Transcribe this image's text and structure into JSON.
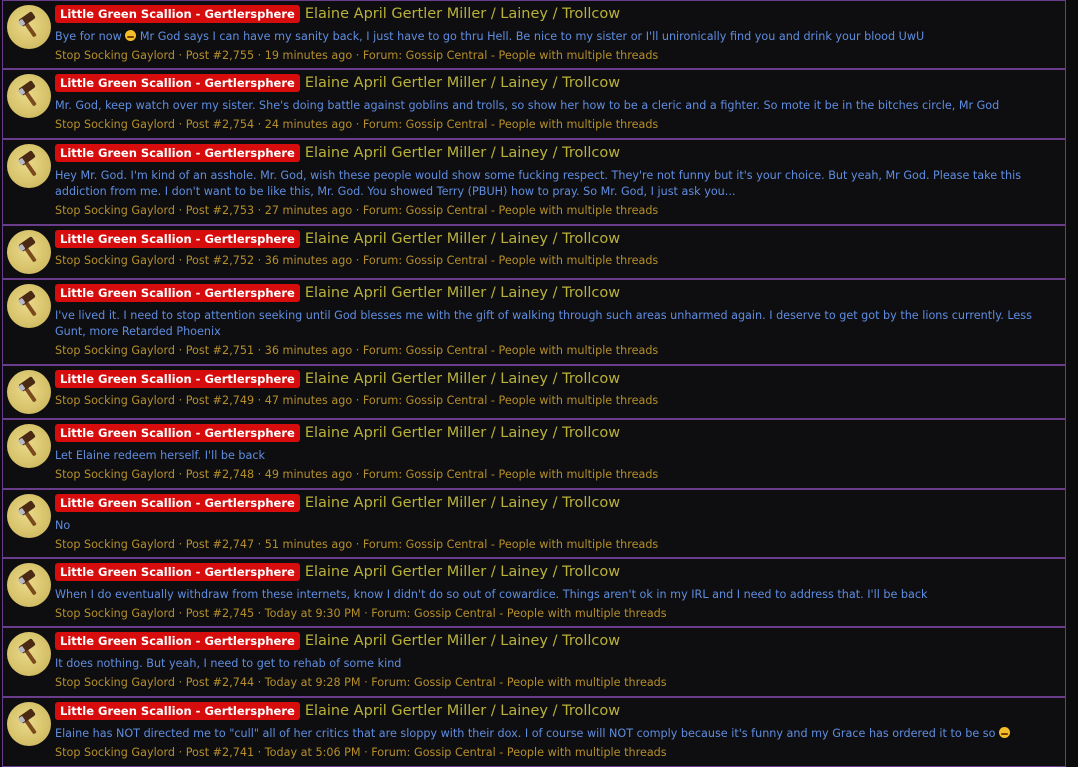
{
  "colors": {
    "badge_bg": "#d70d0d",
    "title": "#b9b13a",
    "text": "#5f8de0",
    "meta": "#b58f2a",
    "border": "#6a3c8c"
  },
  "posts": [
    {
      "badge": "Little Green Scallion - Gertlersphere",
      "title": "Elaine April Gertler Miller / Lainey / Trollcow",
      "text_parts": [
        "Bye for now ",
        " Mr God says I can have my sanity back, I just have to go thru Hell. Be nice to my sister or I'll unironically find you and drink your blood UwU"
      ],
      "author": "Stop Socking Gaylord",
      "post_no": "Post #2,755",
      "time": "19 minutes ago",
      "forum_label": "Forum:",
      "forum": "Gossip Central - People with multiple threads"
    },
    {
      "badge": "Little Green Scallion - Gertlersphere",
      "title": "Elaine April Gertler Miller / Lainey / Trollcow",
      "text_parts": [
        "Mr. God, keep watch over my sister. She's doing battle against goblins and trolls, so show her how to be a cleric and a fighter. So mote it be in the bitches circle, Mr God"
      ],
      "author": "Stop Socking Gaylord",
      "post_no": "Post #2,754",
      "time": "24 minutes ago",
      "forum_label": "Forum:",
      "forum": "Gossip Central - People with multiple threads"
    },
    {
      "badge": "Little Green Scallion - Gertlersphere",
      "title": "Elaine April Gertler Miller / Lainey / Trollcow",
      "text_parts": [
        "Hey Mr. God. I'm kind of an asshole. Mr. God, wish these people would show some fucking respect. They're not funny but it's your choice. But yeah, Mr God. Please take this addiction from me. I don't want to be like this, Mr. God. You showed Terry (PBUH) how to pray. So Mr. God, I just ask you..."
      ],
      "author": "Stop Socking Gaylord",
      "post_no": "Post #2,753",
      "time": "27 minutes ago",
      "forum_label": "Forum:",
      "forum": "Gossip Central - People with multiple threads"
    },
    {
      "badge": "Little Green Scallion - Gertlersphere",
      "title": "Elaine April Gertler Miller / Lainey / Trollcow",
      "text_parts": [],
      "author": "Stop Socking Gaylord",
      "post_no": "Post #2,752",
      "time": "36 minutes ago",
      "forum_label": "Forum:",
      "forum": "Gossip Central - People with multiple threads"
    },
    {
      "badge": "Little Green Scallion - Gertlersphere",
      "title": "Elaine April Gertler Miller / Lainey / Trollcow",
      "text_parts": [
        "I've lived it. I need to stop attention seeking until God blesses me with the gift of walking through such areas unharmed again. I deserve to get got by the lions currently. Less Gunt, more Retarded Phoenix"
      ],
      "author": "Stop Socking Gaylord",
      "post_no": "Post #2,751",
      "time": "36 minutes ago",
      "forum_label": "Forum:",
      "forum": "Gossip Central - People with multiple threads"
    },
    {
      "badge": "Little Green Scallion - Gertlersphere",
      "title": "Elaine April Gertler Miller / Lainey / Trollcow",
      "text_parts": [],
      "author": "Stop Socking Gaylord",
      "post_no": "Post #2,749",
      "time": "47 minutes ago",
      "forum_label": "Forum:",
      "forum": "Gossip Central - People with multiple threads"
    },
    {
      "badge": "Little Green Scallion - Gertlersphere",
      "title": "Elaine April Gertler Miller / Lainey / Trollcow",
      "text_parts": [
        "Let Elaine redeem herself. I'll be back"
      ],
      "author": "Stop Socking Gaylord",
      "post_no": "Post #2,748",
      "time": "49 minutes ago",
      "forum_label": "Forum:",
      "forum": "Gossip Central - People with multiple threads"
    },
    {
      "badge": "Little Green Scallion - Gertlersphere",
      "title": "Elaine April Gertler Miller / Lainey / Trollcow",
      "text_parts": [
        "No"
      ],
      "author": "Stop Socking Gaylord",
      "post_no": "Post #2,747",
      "time": "51 minutes ago",
      "forum_label": "Forum:",
      "forum": "Gossip Central - People with multiple threads"
    },
    {
      "badge": "Little Green Scallion - Gertlersphere",
      "title": "Elaine April Gertler Miller / Lainey / Trollcow",
      "text_parts": [
        "When I do eventually withdraw from these internets, know I didn't do so out of cowardice. Things aren't ok in my IRL and I need to address that. I'll be back"
      ],
      "author": "Stop Socking Gaylord",
      "post_no": "Post #2,745",
      "time": "Today at 9:30 PM",
      "forum_label": "Forum:",
      "forum": "Gossip Central - People with multiple threads"
    },
    {
      "badge": "Little Green Scallion - Gertlersphere",
      "title": "Elaine April Gertler Miller / Lainey / Trollcow",
      "text_parts": [
        "It does nothing. But yeah, I need to get to rehab of some kind"
      ],
      "author": "Stop Socking Gaylord",
      "post_no": "Post #2,744",
      "time": "Today at 9:28 PM",
      "forum_label": "Forum:",
      "forum": "Gossip Central - People with multiple threads"
    },
    {
      "badge": "Little Green Scallion - Gertlersphere",
      "title": "Elaine April Gertler Miller / Lainey / Trollcow",
      "text_parts": [
        "Elaine has NOT directed me to \"cull\" all of her critics that are sloppy with their dox. I of course will NOT comply because it's funny and my Grace has ordered it to be so ",
        ""
      ],
      "author": "Stop Socking Gaylord",
      "post_no": "Post #2,741",
      "time": "Today at 5:06 PM",
      "forum_label": "Forum:",
      "forum": "Gossip Central - People with multiple threads"
    }
  ]
}
